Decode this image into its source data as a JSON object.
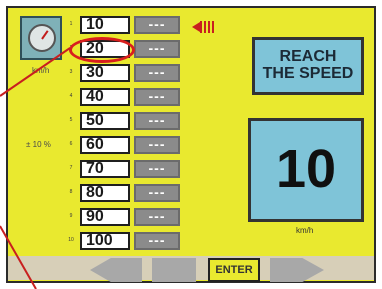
{
  "left_panel": {
    "gauge_icon": "speedometer-icon",
    "unit": "km/h",
    "tolerance": "± 10 %"
  },
  "speed_list": [
    {
      "index": "1",
      "value": "10",
      "result": "---"
    },
    {
      "index": "2",
      "value": "20",
      "result": "---"
    },
    {
      "index": "3",
      "value": "30",
      "result": "---"
    },
    {
      "index": "4",
      "value": "40",
      "result": "---"
    },
    {
      "index": "5",
      "value": "50",
      "result": "---"
    },
    {
      "index": "6",
      "value": "60",
      "result": "---"
    },
    {
      "index": "7",
      "value": "70",
      "result": "---"
    },
    {
      "index": "8",
      "value": "80",
      "result": "---"
    },
    {
      "index": "9",
      "value": "90",
      "result": "---"
    },
    {
      "index": "10",
      "value": "100",
      "result": "---"
    }
  ],
  "reach_panel": {
    "line1": "REACH",
    "line2": "THE SPEED"
  },
  "speed_display": {
    "value": "10",
    "unit": "km/h"
  },
  "bottom_nav": {
    "enter_label": "ENTER"
  },
  "colors": {
    "panel_bg": "#e9e92f",
    "accent": "#7fc4d8",
    "highlight": "#d81e1e"
  }
}
